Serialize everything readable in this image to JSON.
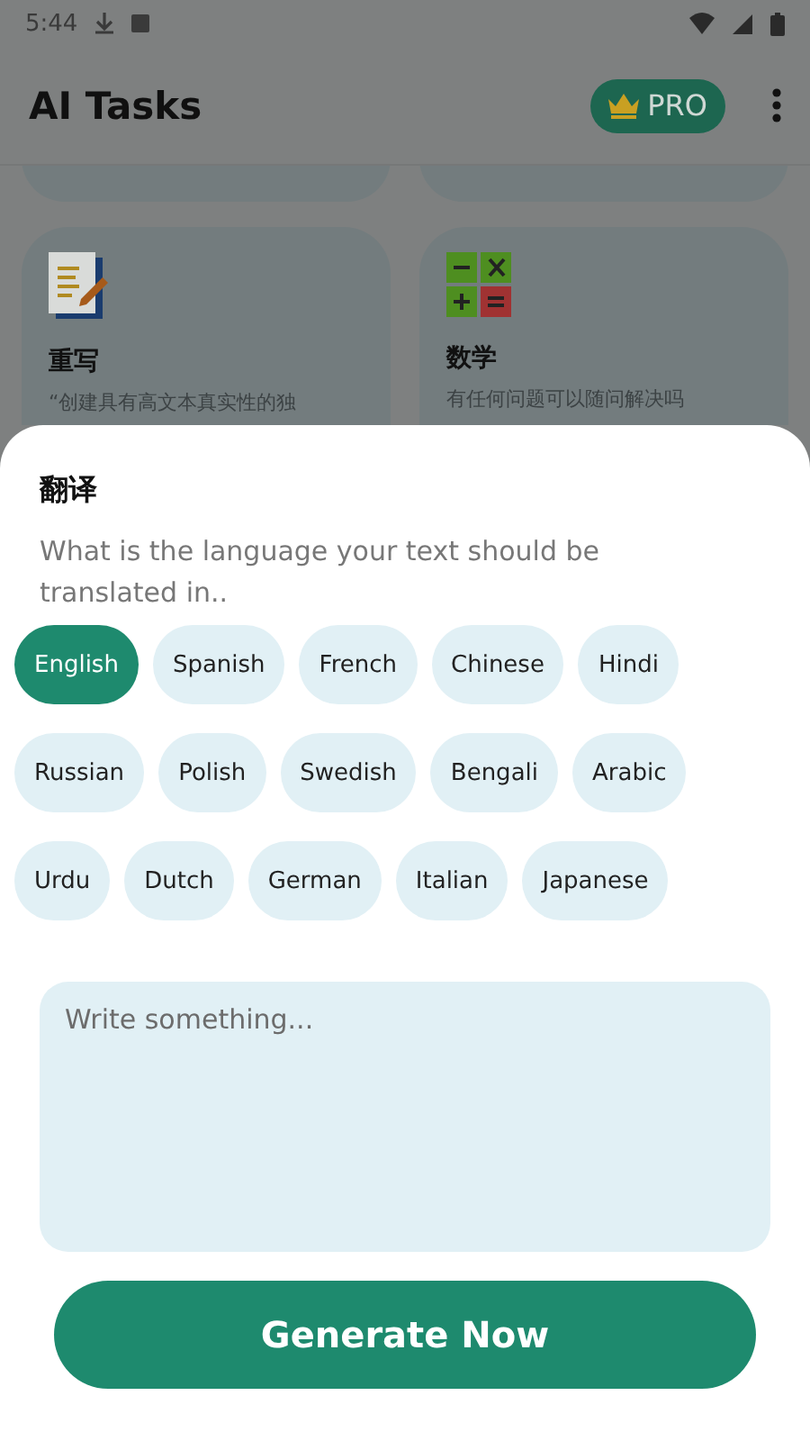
{
  "status_bar": {
    "time": "5:44"
  },
  "app_bar": {
    "title": "AI Tasks",
    "pro_label": "PRO"
  },
  "tasks": [
    {
      "kind": "cut"
    },
    {
      "kind": "cut"
    },
    {
      "kind": "rewrite",
      "title": "重写",
      "description": "“创建具有高文本真实性的独"
    },
    {
      "kind": "math",
      "title": "数学",
      "description": "有任何问题可以随问解决吗"
    }
  ],
  "sheet": {
    "title": "翻译",
    "prompt": "What is the language your text should be translated in..",
    "languages": [
      {
        "label": "English",
        "selected": true
      },
      {
        "label": "Spanish",
        "selected": false
      },
      {
        "label": "French",
        "selected": false
      },
      {
        "label": "Chinese",
        "selected": false
      },
      {
        "label": "Hindi",
        "selected": false
      },
      {
        "label": "Russian",
        "selected": false
      },
      {
        "label": "Polish",
        "selected": false
      },
      {
        "label": "Swedish",
        "selected": false
      },
      {
        "label": "Bengali",
        "selected": false
      },
      {
        "label": "Arabic",
        "selected": false
      },
      {
        "label": "Urdu",
        "selected": false
      },
      {
        "label": "Dutch",
        "selected": false
      },
      {
        "label": "German",
        "selected": false
      },
      {
        "label": "Italian",
        "selected": false
      },
      {
        "label": "Japanese",
        "selected": false
      }
    ],
    "input": {
      "placeholder": "Write something..."
    },
    "button": "Generate Now"
  }
}
